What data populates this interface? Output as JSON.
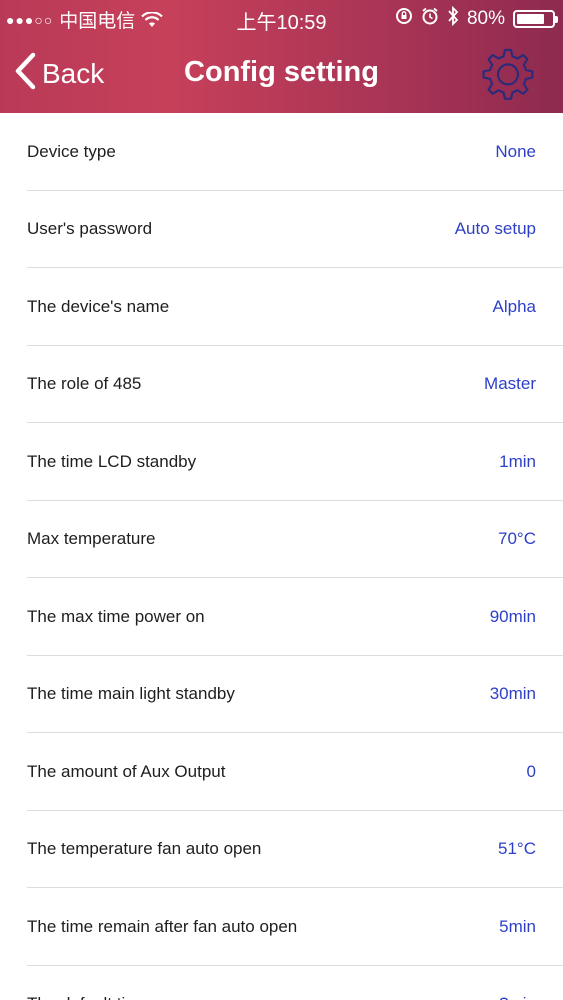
{
  "status_bar": {
    "signal": "●●●○○",
    "carrier": "中国电信",
    "time": "上午10:59",
    "battery_percent": "80%",
    "battery_level": 0.8
  },
  "nav": {
    "back_label": "Back",
    "title": "Config setting",
    "settings_icon": "gear-icon"
  },
  "colors": {
    "header_gradient_start": "#b93a58",
    "header_gradient_end": "#8e2a50",
    "value_text": "#2f40c8",
    "label_text": "#1e1e1e",
    "divider": "#dcdcdc"
  },
  "settings": [
    {
      "label": "Device type",
      "value": "None"
    },
    {
      "label": "User's password",
      "value": "Auto setup"
    },
    {
      "label": "The device's name",
      "value": "Alpha"
    },
    {
      "label": "The role of 485",
      "value": "Master"
    },
    {
      "label": "The time LCD standby",
      "value": "1min"
    },
    {
      "label": "Max temperature",
      "value": "70°C"
    },
    {
      "label": "The max time power on",
      "value": "90min"
    },
    {
      "label": "The time main light standby",
      "value": "30min"
    },
    {
      "label": "The amount of Aux Output",
      "value": "0"
    },
    {
      "label": "The temperature fan auto open",
      "value": "51°C"
    },
    {
      "label": "The time remain after fan auto open",
      "value": "5min"
    },
    {
      "label": "The default time",
      "value": "?min"
    }
  ]
}
